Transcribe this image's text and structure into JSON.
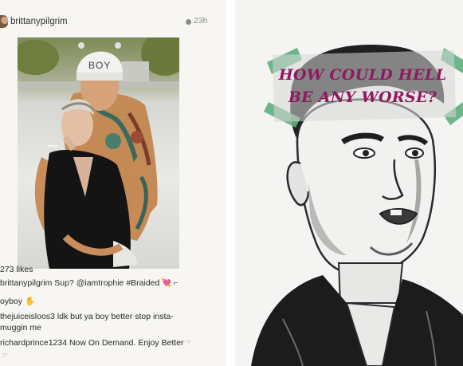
{
  "post": {
    "username": "brittanypilgrim",
    "time_ago": "23h",
    "cap_text": "BOY",
    "likes": "273 likes",
    "caption": {
      "user": "brittanypilgrim",
      "text": " Sup? @iamtrophie #Braided"
    },
    "comments": [
      {
        "text": "oyboy"
      },
      {
        "text": "thejuiceisloos3 ldk but ya boy better stop insta-"
      },
      {
        "text": "muggin me"
      },
      {
        "text": "richardprince1234 Now On Demand. Enjoy Better"
      }
    ],
    "icons": [
      "heart-icon",
      "gun-icon",
      "clap-icon",
      "hand-point-icon"
    ]
  },
  "drawing": {
    "quote_lines": [
      "HOW COULD HELL",
      "BE ANY WORSE?"
    ],
    "quote_color": "#8d1a5f",
    "tape_color": "#5fae7e"
  }
}
